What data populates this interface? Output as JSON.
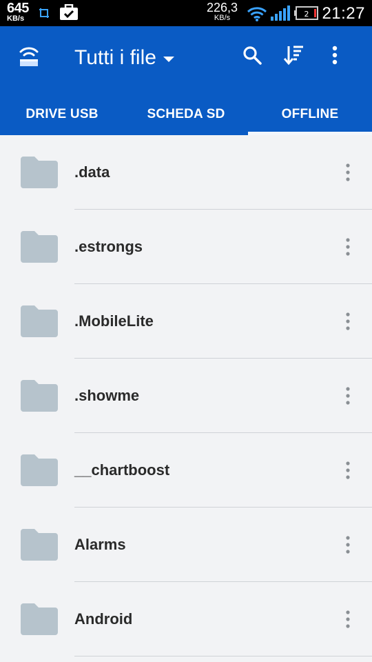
{
  "status_bar": {
    "speed_left_value": "645",
    "speed_left_unit": "KB/s",
    "speed_right_value": "226,3",
    "speed_right_unit": "KB/s",
    "battery_level": "2",
    "time": "21:27",
    "icons": [
      "screenshot-icon",
      "briefcase-check-icon",
      "wifi-icon",
      "signal-icon",
      "battery-icon"
    ]
  },
  "app_bar": {
    "logo_icon": "drive-icon",
    "title": "Tutti i file",
    "actions": [
      "search-icon",
      "sort-icon",
      "more-vert-icon"
    ],
    "accent_color": "#0a5bc4"
  },
  "tabs": [
    {
      "label": "DRIVE USB",
      "selected": false
    },
    {
      "label": "SCHEDA SD",
      "selected": false
    },
    {
      "label": "OFFLINE",
      "selected": true
    }
  ],
  "files": [
    {
      "name": ".data"
    },
    {
      "name": ".estrongs"
    },
    {
      "name": ".MobileLite"
    },
    {
      "name": ".showme"
    },
    {
      "name": "__chartboost"
    },
    {
      "name": "Alarms"
    },
    {
      "name": "Android"
    }
  ]
}
